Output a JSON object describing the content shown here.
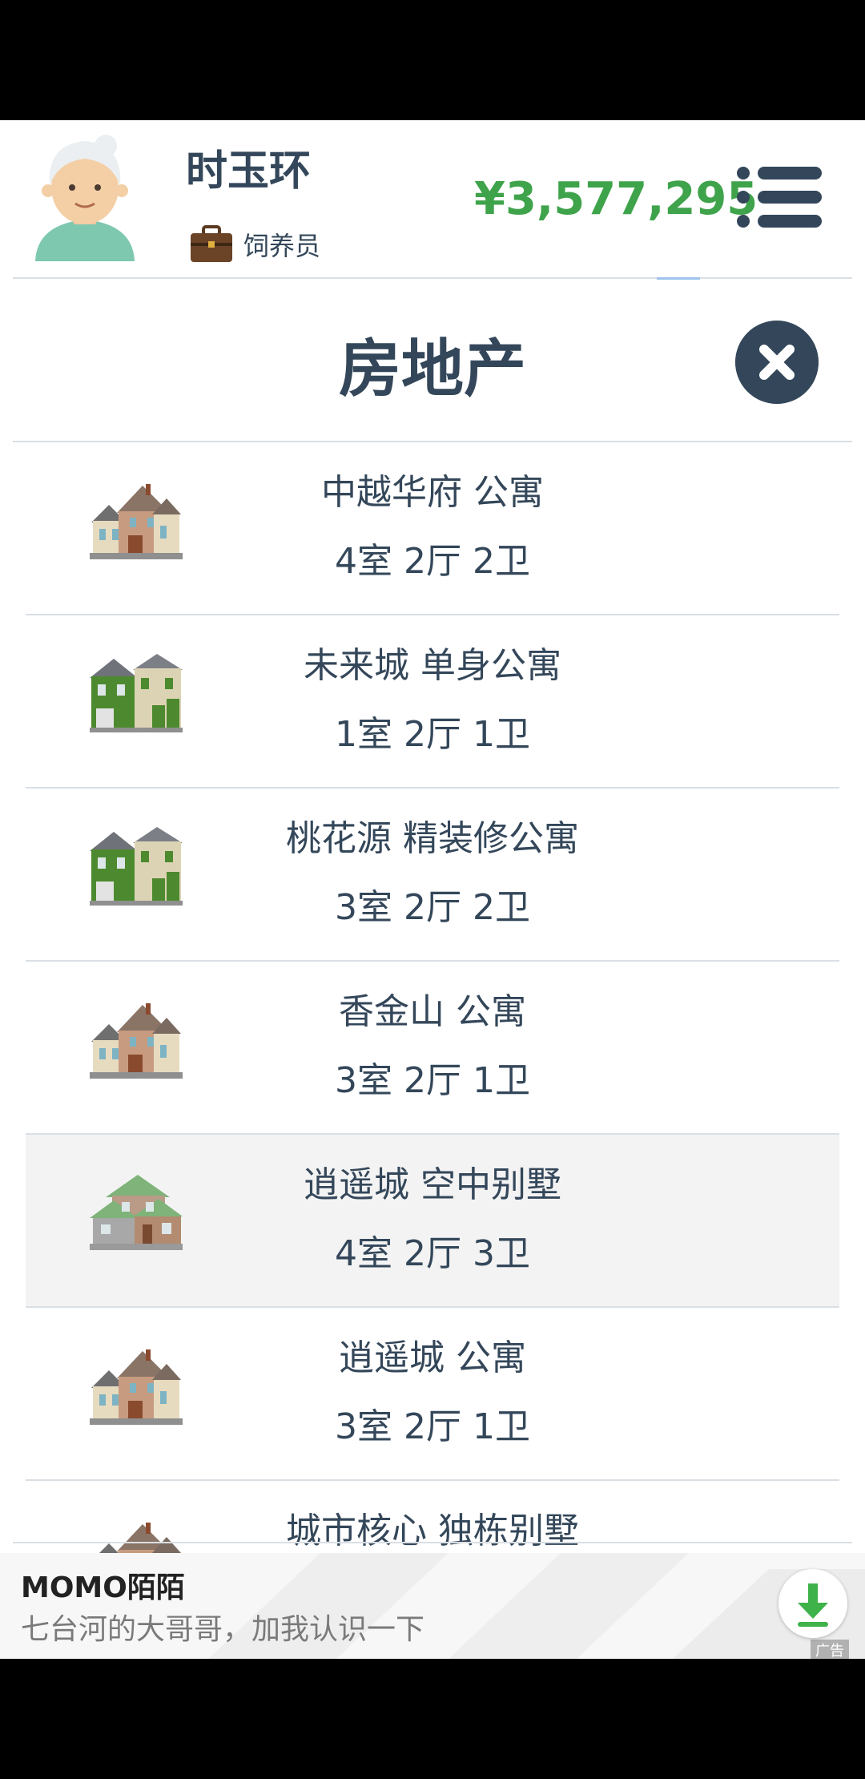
{
  "header": {
    "player_name": "时玉环",
    "job": "饲养员",
    "money": "¥3,577,295"
  },
  "panel": {
    "title": "房地产"
  },
  "properties": [
    {
      "name": "中越华府 公寓",
      "rooms": "4室 2厅 2卫",
      "icon": "house-beige"
    },
    {
      "name": "未来城 单身公寓",
      "rooms": "1室 2厅 1卫",
      "icon": "house-green"
    },
    {
      "name": "桃花源 精装修公寓",
      "rooms": "3室 2厅 2卫",
      "icon": "house-green"
    },
    {
      "name": "香金山 公寓",
      "rooms": "3室 2厅 1卫",
      "icon": "house-beige"
    },
    {
      "name": "逍遥城 空中别墅",
      "rooms": "4室 2厅 3卫",
      "icon": "villa"
    },
    {
      "name": "逍遥城 公寓",
      "rooms": "3室 2厅 1卫",
      "icon": "house-beige"
    },
    {
      "name": "城市核心 独栋别墅",
      "rooms": "",
      "icon": "house-beige"
    }
  ],
  "ad": {
    "title": "MOMO陌陌",
    "subtitle": "七台河的大哥哥，加我认识一下",
    "tag": "广告"
  },
  "colors": {
    "primary": "#34475a",
    "money": "#3fa34b",
    "divider": "#dadfe4",
    "highlight_row": "#f3f3f3"
  }
}
